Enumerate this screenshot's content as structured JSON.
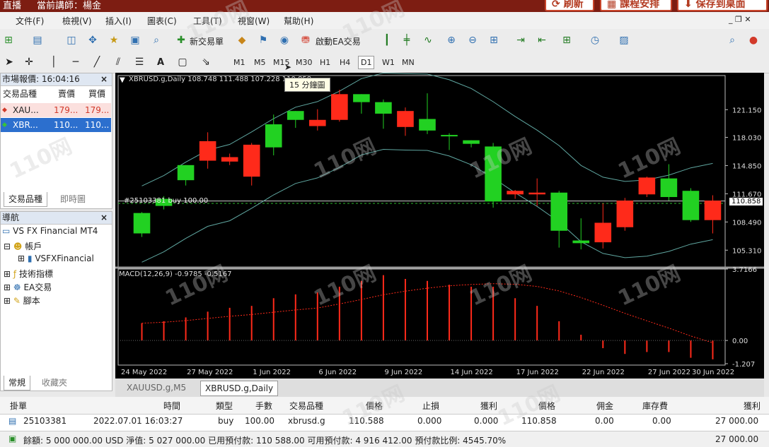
{
  "topbar": {
    "live": "直播",
    "teacher": "當前講師：楊金",
    "refresh": "刷新",
    "schedule": "課程安排",
    "save_desktop": "保存到桌面"
  },
  "menu": [
    "文件(F)",
    "檢視(V)",
    "插入(I)",
    "圖表(C)",
    "工具(T)",
    "視窗(W)",
    "幫助(H)"
  ],
  "toolbar": {
    "new_order": "新交易單",
    "ea_trade": "啟動EA交易",
    "text_tool": "A",
    "timeframes": [
      "M1",
      "M5",
      "M15",
      "M30",
      "H1",
      "H4",
      "D1",
      "W1",
      "MN"
    ],
    "active_tf": "D1",
    "tooltip": "15 分鐘圖"
  },
  "market_watch": {
    "title": "市場報價: 16:04:16",
    "headers": [
      "交易品種",
      "賣價",
      "買價"
    ],
    "rows": [
      {
        "symbol": "XAU...",
        "bid": "179...",
        "ask": "179..."
      },
      {
        "symbol": "XBR...",
        "bid": "110...",
        "ask": "110..."
      }
    ],
    "tabs": [
      "交易品種",
      "即時圖"
    ]
  },
  "navigator": {
    "title": "導航",
    "root": "VS FX Financial MT4",
    "items": [
      "帳戶",
      "VSFXFinancial",
      "技術指標",
      "EA交易",
      "腳本"
    ],
    "tabs": [
      "常規",
      "收藏夾"
    ]
  },
  "chart": {
    "header": "XBRUSD.g,Daily  108.748 111.488 107.228 110.858",
    "order_line_label": "#25103381 buy 100.00",
    "current_price": "110.858",
    "macd_label": "MACD(12,26,9) -0.9785 -0.5167",
    "price_ticks": [
      "121.150",
      "118.030",
      "114.850",
      "111.670",
      "108.490",
      "105.310"
    ],
    "macd_ticks": [
      "3.7166",
      "0.00",
      "-1.207"
    ],
    "date_ticks": [
      "24 May 2022",
      "27 May 2022",
      "1 Jun 2022",
      "6 Jun 2022",
      "9 Jun 2022",
      "14 Jun 2022",
      "17 Jun 2022",
      "22 Jun 2022",
      "27 Jun 2022",
      "30 Jun 2022"
    ],
    "watermark": "110网"
  },
  "chart_tabs": [
    "XAUUSD.g,M5",
    "XBRUSD.g,Daily"
  ],
  "terminal": {
    "headers": [
      "掛單",
      "時間",
      "類型",
      "手數",
      "交易品種",
      "價格",
      "止損",
      "獲利",
      "價格",
      "佣金",
      "庫存費",
      "獲利"
    ],
    "order": [
      "25103381",
      "2022.07.01 16:03:27",
      "buy",
      "100.00",
      "xbrusd.g",
      "110.588",
      "0.000",
      "0.000",
      "110.858",
      "0.00",
      "0.00",
      "27 000.00"
    ],
    "summary": "餘額: 5 000 000.00 USD  淨值: 5 027 000.00  已用預付款: 110 588.00  可用預付款: 4 916 412.00  預付款比例: 4545.70%",
    "summary_profit": "27 000.00"
  },
  "chart_data": {
    "type": "candlestick",
    "candles": [
      {
        "o": 107.2,
        "h": 109.6,
        "l": 106.8,
        "c": 109.5,
        "dir": "up"
      },
      {
        "o": 110.3,
        "h": 111.4,
        "l": 109.9,
        "c": 111.1,
        "dir": "up"
      },
      {
        "o": 113.2,
        "h": 114.9,
        "l": 112.6,
        "c": 114.9,
        "dir": "up"
      },
      {
        "o": 117.6,
        "h": 118.6,
        "l": 114.5,
        "c": 115.4,
        "dir": "down"
      },
      {
        "o": 115.8,
        "h": 116.2,
        "l": 114.9,
        "c": 115.3,
        "dir": "down"
      },
      {
        "o": 117.2,
        "h": 117.4,
        "l": 112.6,
        "c": 113.6,
        "dir": "down"
      },
      {
        "o": 116.9,
        "h": 120.6,
        "l": 116.0,
        "c": 119.5,
        "dir": "up"
      },
      {
        "o": 120.0,
        "h": 121.0,
        "l": 119.1,
        "c": 121.0,
        "dir": "up"
      },
      {
        "o": 120.0,
        "h": 121.2,
        "l": 118.8,
        "c": 119.3,
        "dir": "down"
      },
      {
        "o": 122.9,
        "h": 123.4,
        "l": 119.8,
        "c": 120.0,
        "dir": "down"
      },
      {
        "o": 122.0,
        "h": 122.9,
        "l": 120.7,
        "c": 122.9,
        "dir": "up"
      },
      {
        "o": 122.0,
        "h": 122.3,
        "l": 119.0,
        "c": 120.7,
        "dir": "up"
      },
      {
        "o": 121.0,
        "h": 121.4,
        "l": 118.2,
        "c": 119.2,
        "dir": "down"
      },
      {
        "o": 118.8,
        "h": 123.0,
        "l": 118.4,
        "c": 120.1,
        "dir": "up"
      },
      {
        "o": 118.3,
        "h": 118.5,
        "l": 116.6,
        "c": 118.3,
        "dir": "up"
      },
      {
        "o": 117.3,
        "h": 117.7,
        "l": 116.9,
        "c": 117.7,
        "dir": "up"
      },
      {
        "o": 117.0,
        "h": 117.4,
        "l": 110.1,
        "c": 110.8,
        "dir": "up"
      },
      {
        "o": 111.6,
        "h": 112.1,
        "l": 111.1,
        "c": 112.0,
        "dir": "down"
      },
      {
        "o": 111.6,
        "h": 113.4,
        "l": 110.3,
        "c": 111.8,
        "dir": "down"
      },
      {
        "o": 111.8,
        "h": 112.0,
        "l": 105.6,
        "c": 107.5,
        "dir": "up"
      },
      {
        "o": 106.4,
        "h": 108.9,
        "l": 105.4,
        "c": 106.1,
        "dir": "up"
      },
      {
        "o": 108.4,
        "h": 110.6,
        "l": 105.5,
        "c": 106.2,
        "dir": "down"
      },
      {
        "o": 110.9,
        "h": 111.2,
        "l": 107.5,
        "c": 107.9,
        "dir": "down"
      },
      {
        "o": 113.5,
        "h": 113.6,
        "l": 111.3,
        "c": 111.6,
        "dir": "down"
      },
      {
        "o": 113.4,
        "h": 115.0,
        "l": 110.9,
        "c": 111.3,
        "dir": "up"
      },
      {
        "o": 112.0,
        "h": 112.3,
        "l": 108.5,
        "c": 108.7,
        "dir": "up"
      },
      {
        "o": 110.9,
        "h": 111.5,
        "l": 107.2,
        "c": 108.7,
        "dir": "down"
      }
    ],
    "macd_bars": [
      0.9,
      1.0,
      1.2,
      1.5,
      1.7,
      1.8,
      2.2,
      2.4,
      2.5,
      2.8,
      3.1,
      3.4,
      3.2,
      3.1,
      2.9,
      2.8,
      2.8,
      2.2,
      1.8,
      1.0,
      0.3,
      -0.4,
      -0.7,
      -0.6,
      -0.6,
      -0.9,
      -0.98
    ],
    "ylim": [
      103.5,
      124.2
    ],
    "macd_ylim": [
      -1.207,
      3.7166
    ]
  }
}
